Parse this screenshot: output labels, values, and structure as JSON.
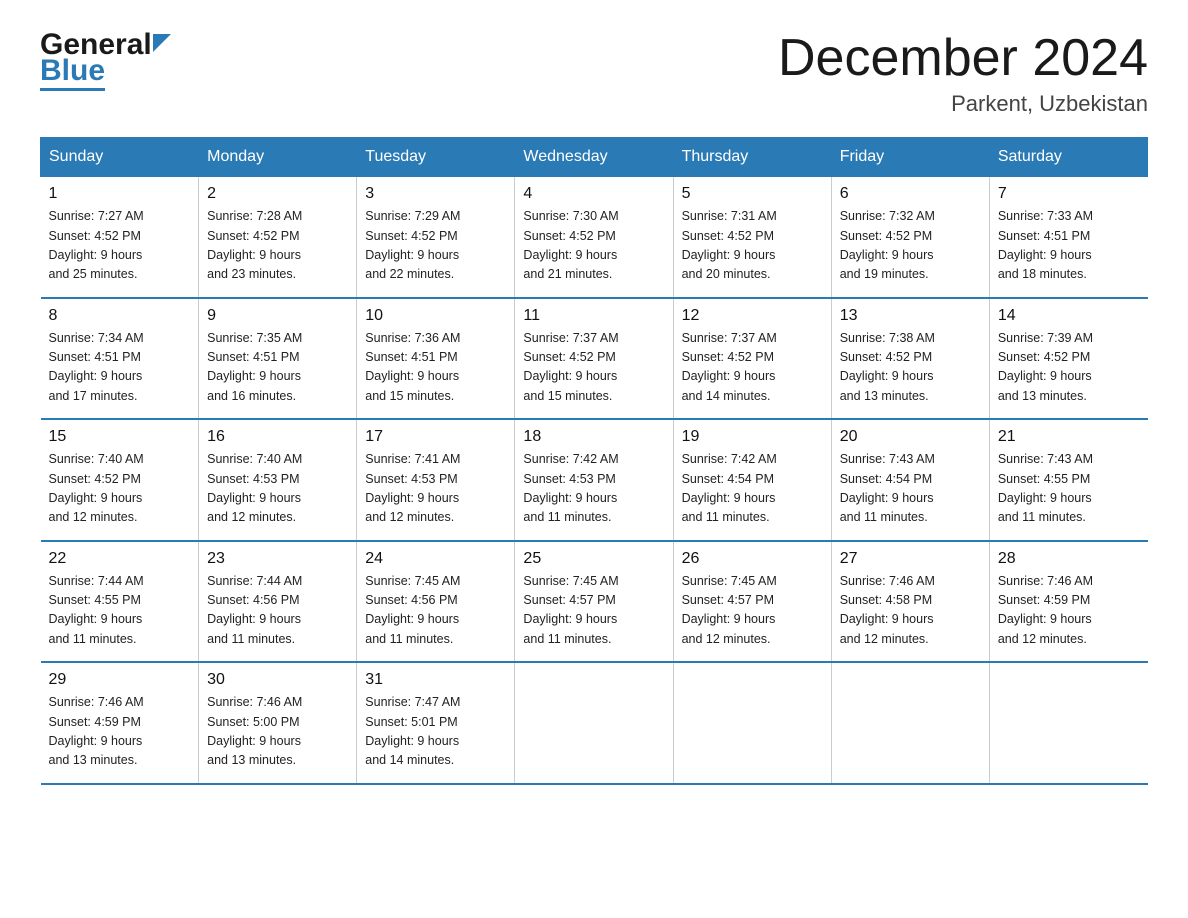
{
  "header": {
    "logo_general": "General",
    "logo_blue": "Blue",
    "month_title": "December 2024",
    "location": "Parkent, Uzbekistan"
  },
  "weekdays": [
    "Sunday",
    "Monday",
    "Tuesday",
    "Wednesday",
    "Thursday",
    "Friday",
    "Saturday"
  ],
  "weeks": [
    [
      {
        "day": "1",
        "sunrise": "7:27 AM",
        "sunset": "4:52 PM",
        "daylight": "9 hours and 25 minutes."
      },
      {
        "day": "2",
        "sunrise": "7:28 AM",
        "sunset": "4:52 PM",
        "daylight": "9 hours and 23 minutes."
      },
      {
        "day": "3",
        "sunrise": "7:29 AM",
        "sunset": "4:52 PM",
        "daylight": "9 hours and 22 minutes."
      },
      {
        "day": "4",
        "sunrise": "7:30 AM",
        "sunset": "4:52 PM",
        "daylight": "9 hours and 21 minutes."
      },
      {
        "day": "5",
        "sunrise": "7:31 AM",
        "sunset": "4:52 PM",
        "daylight": "9 hours and 20 minutes."
      },
      {
        "day": "6",
        "sunrise": "7:32 AM",
        "sunset": "4:52 PM",
        "daylight": "9 hours and 19 minutes."
      },
      {
        "day": "7",
        "sunrise": "7:33 AM",
        "sunset": "4:51 PM",
        "daylight": "9 hours and 18 minutes."
      }
    ],
    [
      {
        "day": "8",
        "sunrise": "7:34 AM",
        "sunset": "4:51 PM",
        "daylight": "9 hours and 17 minutes."
      },
      {
        "day": "9",
        "sunrise": "7:35 AM",
        "sunset": "4:51 PM",
        "daylight": "9 hours and 16 minutes."
      },
      {
        "day": "10",
        "sunrise": "7:36 AM",
        "sunset": "4:51 PM",
        "daylight": "9 hours and 15 minutes."
      },
      {
        "day": "11",
        "sunrise": "7:37 AM",
        "sunset": "4:52 PM",
        "daylight": "9 hours and 15 minutes."
      },
      {
        "day": "12",
        "sunrise": "7:37 AM",
        "sunset": "4:52 PM",
        "daylight": "9 hours and 14 minutes."
      },
      {
        "day": "13",
        "sunrise": "7:38 AM",
        "sunset": "4:52 PM",
        "daylight": "9 hours and 13 minutes."
      },
      {
        "day": "14",
        "sunrise": "7:39 AM",
        "sunset": "4:52 PM",
        "daylight": "9 hours and 13 minutes."
      }
    ],
    [
      {
        "day": "15",
        "sunrise": "7:40 AM",
        "sunset": "4:52 PM",
        "daylight": "9 hours and 12 minutes."
      },
      {
        "day": "16",
        "sunrise": "7:40 AM",
        "sunset": "4:53 PM",
        "daylight": "9 hours and 12 minutes."
      },
      {
        "day": "17",
        "sunrise": "7:41 AM",
        "sunset": "4:53 PM",
        "daylight": "9 hours and 12 minutes."
      },
      {
        "day": "18",
        "sunrise": "7:42 AM",
        "sunset": "4:53 PM",
        "daylight": "9 hours and 11 minutes."
      },
      {
        "day": "19",
        "sunrise": "7:42 AM",
        "sunset": "4:54 PM",
        "daylight": "9 hours and 11 minutes."
      },
      {
        "day": "20",
        "sunrise": "7:43 AM",
        "sunset": "4:54 PM",
        "daylight": "9 hours and 11 minutes."
      },
      {
        "day": "21",
        "sunrise": "7:43 AM",
        "sunset": "4:55 PM",
        "daylight": "9 hours and 11 minutes."
      }
    ],
    [
      {
        "day": "22",
        "sunrise": "7:44 AM",
        "sunset": "4:55 PM",
        "daylight": "9 hours and 11 minutes."
      },
      {
        "day": "23",
        "sunrise": "7:44 AM",
        "sunset": "4:56 PM",
        "daylight": "9 hours and 11 minutes."
      },
      {
        "day": "24",
        "sunrise": "7:45 AM",
        "sunset": "4:56 PM",
        "daylight": "9 hours and 11 minutes."
      },
      {
        "day": "25",
        "sunrise": "7:45 AM",
        "sunset": "4:57 PM",
        "daylight": "9 hours and 11 minutes."
      },
      {
        "day": "26",
        "sunrise": "7:45 AM",
        "sunset": "4:57 PM",
        "daylight": "9 hours and 12 minutes."
      },
      {
        "day": "27",
        "sunrise": "7:46 AM",
        "sunset": "4:58 PM",
        "daylight": "9 hours and 12 minutes."
      },
      {
        "day": "28",
        "sunrise": "7:46 AM",
        "sunset": "4:59 PM",
        "daylight": "9 hours and 12 minutes."
      }
    ],
    [
      {
        "day": "29",
        "sunrise": "7:46 AM",
        "sunset": "4:59 PM",
        "daylight": "9 hours and 13 minutes."
      },
      {
        "day": "30",
        "sunrise": "7:46 AM",
        "sunset": "5:00 PM",
        "daylight": "9 hours and 13 minutes."
      },
      {
        "day": "31",
        "sunrise": "7:47 AM",
        "sunset": "5:01 PM",
        "daylight": "9 hours and 14 minutes."
      },
      null,
      null,
      null,
      null
    ]
  ],
  "labels": {
    "sunrise": "Sunrise: ",
    "sunset": "Sunset: ",
    "daylight": "Daylight: "
  }
}
